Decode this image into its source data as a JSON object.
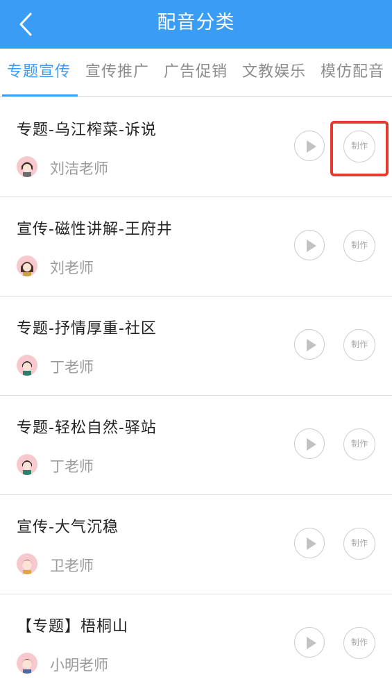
{
  "header": {
    "title": "配音分类",
    "back_icon": "chevron-left-icon"
  },
  "tabs": [
    {
      "label": "专题宣传",
      "active": true
    },
    {
      "label": "宣传推广",
      "active": false
    },
    {
      "label": "广告促销",
      "active": false
    },
    {
      "label": "文教娱乐",
      "active": false
    },
    {
      "label": "模仿配音",
      "active": false
    }
  ],
  "items": [
    {
      "title": "专题-乌江榨菜-诉说",
      "author": "刘洁老师",
      "make_label": "制作"
    },
    {
      "title": "宣传-磁性讲解-王府井",
      "author": "刘老师",
      "make_label": "制作"
    },
    {
      "title": "专题-抒情厚重-社区",
      "author": "丁老师",
      "make_label": "制作"
    },
    {
      "title": "专题-轻松自然-驿站",
      "author": "丁老师",
      "make_label": "制作"
    },
    {
      "title": "宣传-大气沉稳",
      "author": "卫老师",
      "make_label": "制作"
    },
    {
      "title": "【专题】梧桐山",
      "author": "小明老师",
      "make_label": "制作"
    }
  ],
  "colors": {
    "accent": "#3a9df5",
    "highlight": "#e53a2e"
  }
}
